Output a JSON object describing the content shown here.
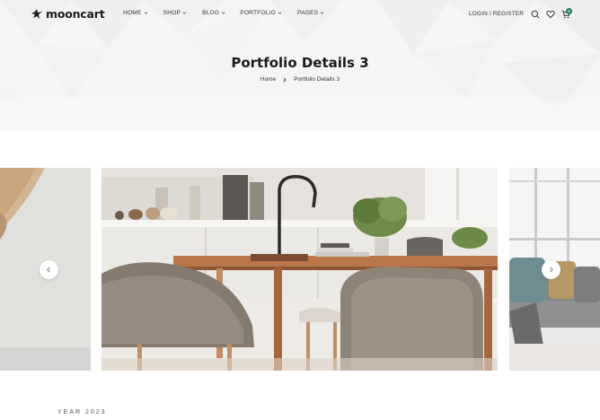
{
  "brand": {
    "name": "mooncart",
    "logo_icon": "bird-logo-icon"
  },
  "nav": {
    "items": [
      {
        "label": "HOME"
      },
      {
        "label": "SHOP"
      },
      {
        "label": "BLOG"
      },
      {
        "label": "PORTFOLIO"
      },
      {
        "label": "PAGES"
      }
    ]
  },
  "header": {
    "login_label": "LOGIN / REGISTER",
    "cart_count": "0",
    "icons": [
      "search-icon",
      "heart-icon",
      "cart-icon"
    ]
  },
  "hero": {
    "title": "Portfolio Details 3",
    "breadcrumb": [
      "Home",
      "Portfolio Details 3"
    ]
  },
  "gallery": {
    "prev_icon": "chevron-left-icon",
    "next_icon": "chevron-right-icon"
  },
  "details": {
    "year_label": "YEAR 2023"
  },
  "colors": {
    "accent": "#1d7f5e",
    "hero_bg": "#f6f6f6",
    "text": "#1b1b1b"
  }
}
